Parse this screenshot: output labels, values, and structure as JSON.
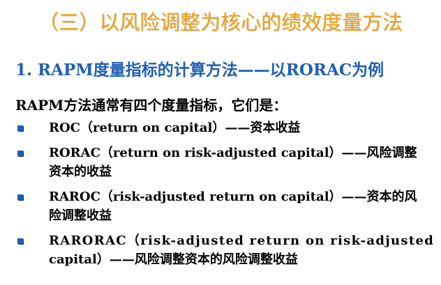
{
  "slide": {
    "title": "（三）以风险调整为核心的绩效度量方法",
    "subtitle": "1. RAPM度量指标的计算方法——以RORAC为例",
    "intro": "RAPM方法通常有四个度量指标，它们是：",
    "bullets": [
      {
        "line1": "ROC（return on capital）——资本收益",
        "line2": ""
      },
      {
        "line1": "RORAC（return on risk-adjusted capital）——风险调整",
        "line2": "资本的收益"
      },
      {
        "line1": "RAROC（risk-adjusted return on capital）——资本的风",
        "line2": "险调整收益"
      },
      {
        "line1": "RARORAC（risk-adjusted return on risk-adjusted",
        "line2": "capital）——风险调整资本的风险调整收益"
      }
    ]
  },
  "colors": {
    "title": "#e8a41c",
    "subtitle": "#1f5fb4",
    "bullet": "#1f5fb4",
    "text": "#000000"
  },
  "icons": {
    "bullet": "square-bullet-icon"
  }
}
